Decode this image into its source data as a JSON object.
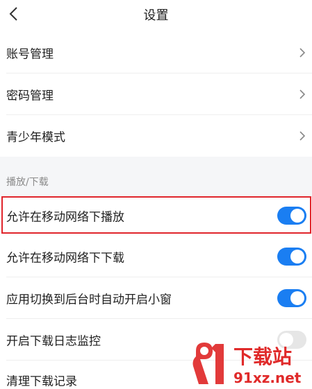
{
  "header": {
    "title": "设置"
  },
  "account_rows": [
    {
      "label": "账号管理"
    },
    {
      "label": "密码管理"
    },
    {
      "label": "青少年模式"
    }
  ],
  "section": {
    "title": "播放/下载"
  },
  "toggle_rows": [
    {
      "label": "允许在移动网络下播放",
      "on": true
    },
    {
      "label": "允许在移动网络下下载",
      "on": true
    },
    {
      "label": "应用切换到后台时自动开启小窗",
      "on": true
    },
    {
      "label": "开启下载日志监控",
      "on": false
    }
  ],
  "last_row": {
    "label": "清理下载记录"
  },
  "watermark": {
    "text": "下载站",
    "url": "91xz.net"
  },
  "colors": {
    "accent": "#1a7ef2",
    "highlight": "#e0242b",
    "watermark_red": "#e02a2a"
  }
}
